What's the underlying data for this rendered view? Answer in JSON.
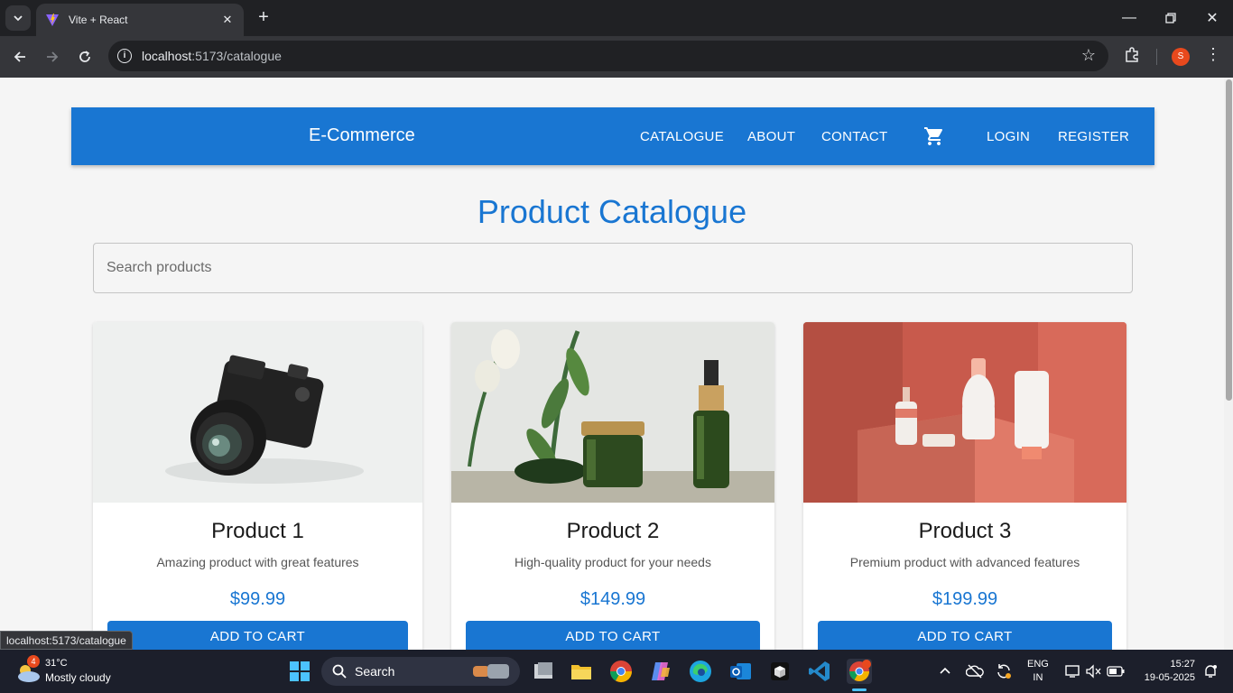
{
  "browser": {
    "tab_title": "Vite + React",
    "url_host": "localhost",
    "url_path": ":5173/catalogue",
    "profile_initial": "S",
    "status_url": "localhost:5173/catalogue"
  },
  "app": {
    "brand": "E-Commerce",
    "nav": [
      "CATALOGUE",
      "ABOUT",
      "CONTACT",
      "LOGIN",
      "REGISTER"
    ],
    "page_title": "Product Catalogue",
    "search_placeholder": "Search products",
    "products": [
      {
        "name": "Product 1",
        "description": "Amazing product with great features",
        "price": "$99.99",
        "button": "ADD TO CART",
        "image": "camera"
      },
      {
        "name": "Product 2",
        "description": "High-quality product for your needs",
        "price": "$149.99",
        "button": "ADD TO CART",
        "image": "cosmetic-bottles-green"
      },
      {
        "name": "Product 3",
        "description": "Premium product with advanced features",
        "price": "$199.99",
        "button": "ADD TO CART",
        "image": "cosmetic-bottles-coral"
      }
    ],
    "colors": {
      "primary": "#1976d2",
      "background": "#f5f5f5"
    }
  },
  "taskbar": {
    "weather_badge": "4",
    "temperature": "31°C",
    "condition": "Mostly cloudy",
    "search_label": "Search",
    "lang_line1": "ENG",
    "lang_line2": "IN",
    "time": "15:27",
    "date": "19-05-2025"
  }
}
